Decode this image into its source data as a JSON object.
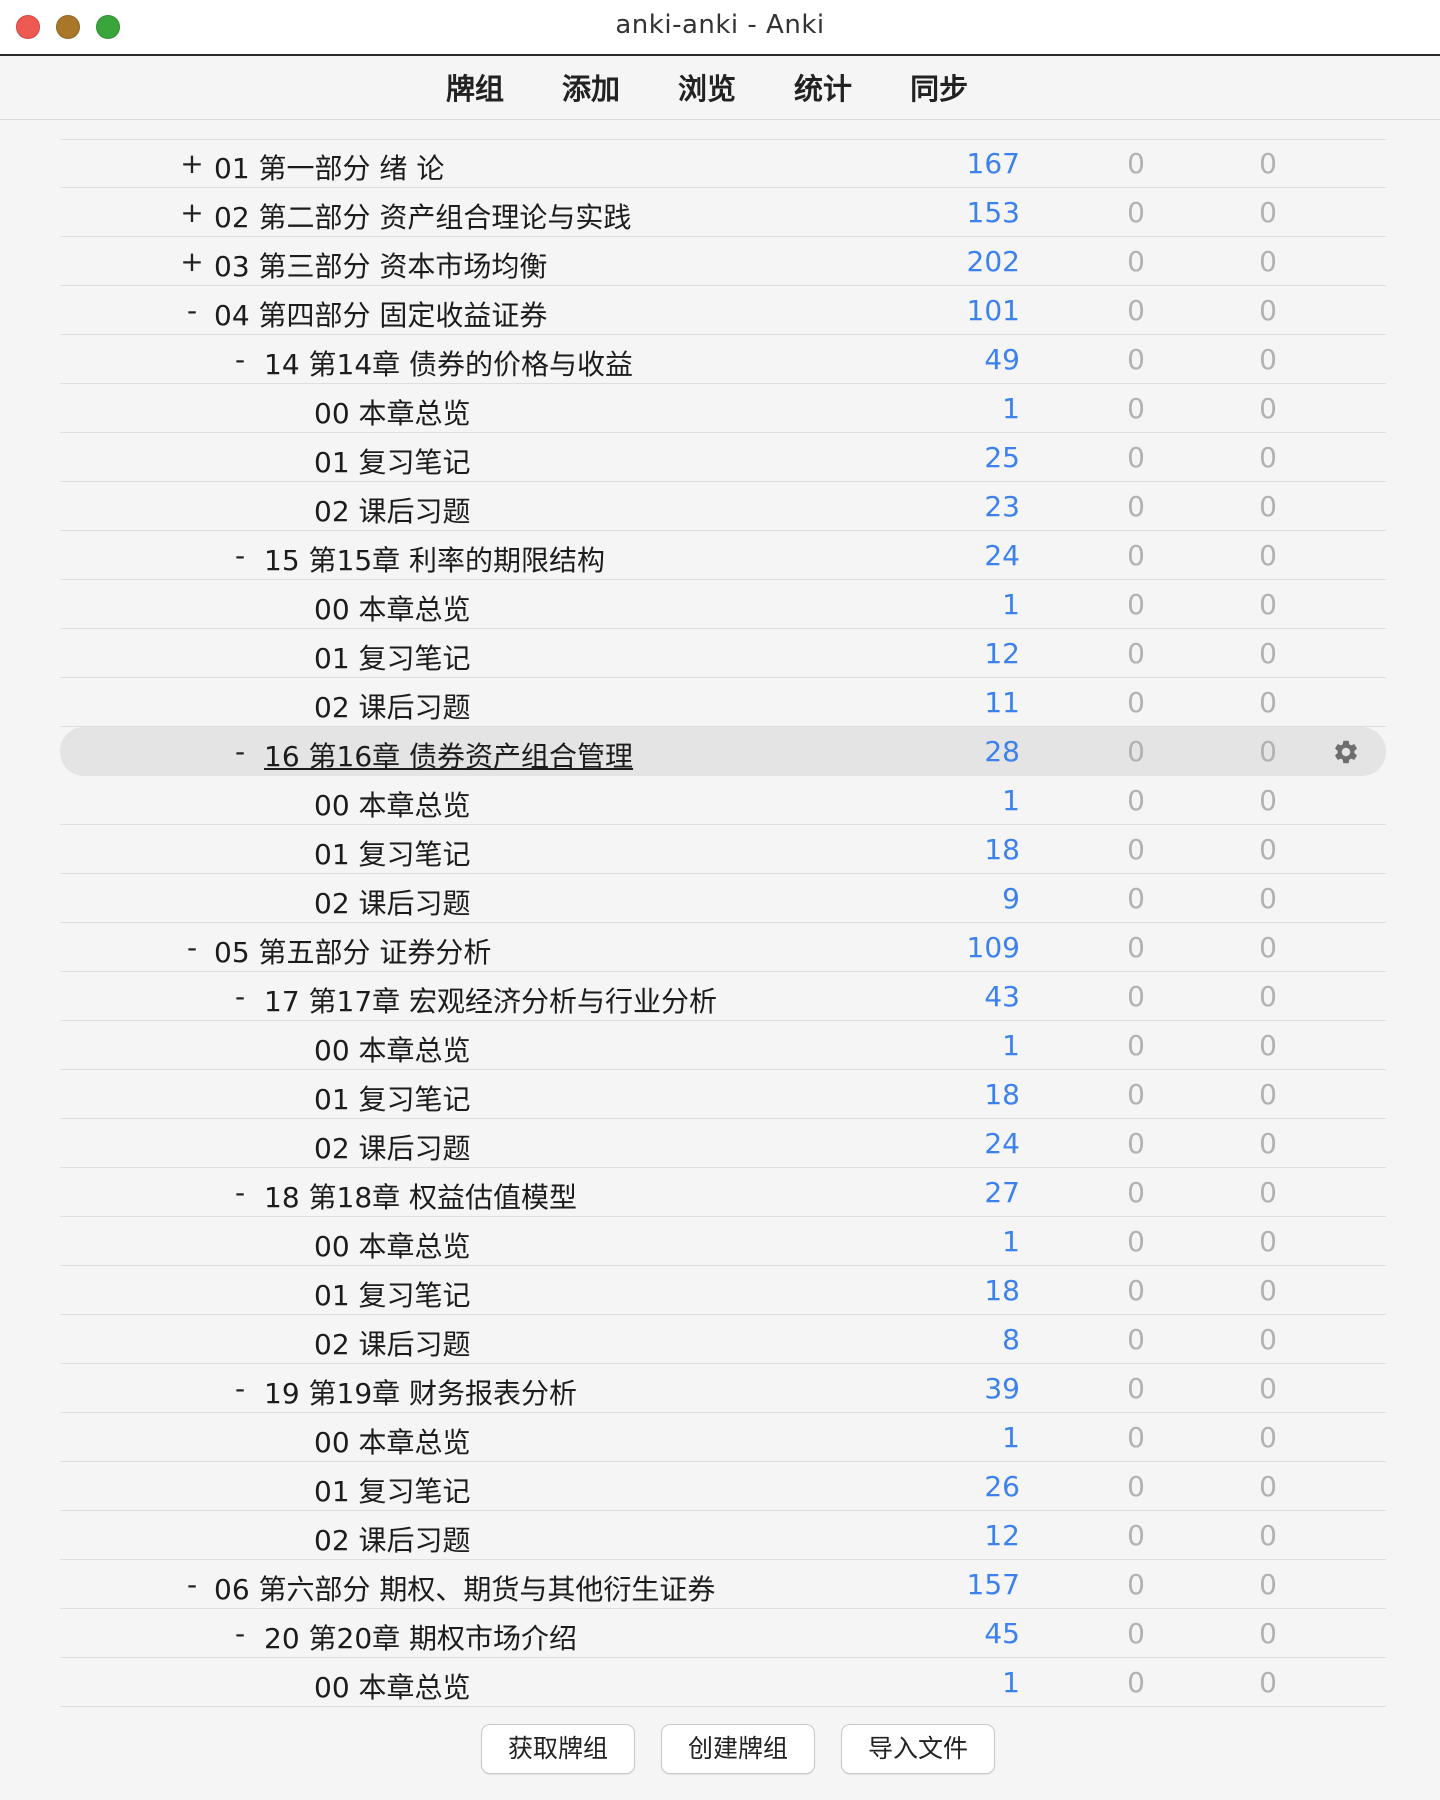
{
  "window": {
    "title": "anki-anki - Anki"
  },
  "toolbar": {
    "tabs": [
      "牌组",
      "添加",
      "浏览",
      "统计",
      "同步"
    ]
  },
  "decks": [
    {
      "toggle": "+",
      "depth": 1,
      "name": "01 第一部分 绪 论",
      "new": "167",
      "c2": "0",
      "c3": "0"
    },
    {
      "toggle": "+",
      "depth": 1,
      "name": "02 第二部分 资产组合理论与实践",
      "new": "153",
      "c2": "0",
      "c3": "0"
    },
    {
      "toggle": "+",
      "depth": 1,
      "name": "03 第三部分 资本市场均衡",
      "new": "202",
      "c2": "0",
      "c3": "0"
    },
    {
      "toggle": "-",
      "depth": 1,
      "name": "04 第四部分 固定收益证券",
      "new": "101",
      "c2": "0",
      "c3": "0"
    },
    {
      "toggle": "-",
      "depth": 2,
      "name": "14 第14章 债券的价格与收益",
      "new": "49",
      "c2": "0",
      "c3": "0"
    },
    {
      "toggle": "",
      "depth": 3,
      "name": "00 本章总览",
      "new": "1",
      "c2": "0",
      "c3": "0"
    },
    {
      "toggle": "",
      "depth": 3,
      "name": "01 复习笔记",
      "new": "25",
      "c2": "0",
      "c3": "0"
    },
    {
      "toggle": "",
      "depth": 3,
      "name": "02 课后习题",
      "new": "23",
      "c2": "0",
      "c3": "0"
    },
    {
      "toggle": "-",
      "depth": 2,
      "name": "15 第15章 利率的期限结构",
      "new": "24",
      "c2": "0",
      "c3": "0"
    },
    {
      "toggle": "",
      "depth": 3,
      "name": "00 本章总览",
      "new": "1",
      "c2": "0",
      "c3": "0"
    },
    {
      "toggle": "",
      "depth": 3,
      "name": "01 复习笔记",
      "new": "12",
      "c2": "0",
      "c3": "0"
    },
    {
      "toggle": "",
      "depth": 3,
      "name": "02 课后习题",
      "new": "11",
      "c2": "0",
      "c3": "0"
    },
    {
      "toggle": "-",
      "depth": 2,
      "name": "16 第16章 债券资产组合管理",
      "new": "28",
      "c2": "0",
      "c3": "0",
      "selected": true
    },
    {
      "toggle": "",
      "depth": 3,
      "name": "00 本章总览",
      "new": "1",
      "c2": "0",
      "c3": "0"
    },
    {
      "toggle": "",
      "depth": 3,
      "name": "01 复习笔记",
      "new": "18",
      "c2": "0",
      "c3": "0"
    },
    {
      "toggle": "",
      "depth": 3,
      "name": "02 课后习题",
      "new": "9",
      "c2": "0",
      "c3": "0"
    },
    {
      "toggle": "-",
      "depth": 1,
      "name": "05 第五部分 证券分析",
      "new": "109",
      "c2": "0",
      "c3": "0"
    },
    {
      "toggle": "-",
      "depth": 2,
      "name": "17 第17章 宏观经济分析与行业分析",
      "new": "43",
      "c2": "0",
      "c3": "0"
    },
    {
      "toggle": "",
      "depth": 3,
      "name": "00 本章总览",
      "new": "1",
      "c2": "0",
      "c3": "0"
    },
    {
      "toggle": "",
      "depth": 3,
      "name": "01 复习笔记",
      "new": "18",
      "c2": "0",
      "c3": "0"
    },
    {
      "toggle": "",
      "depth": 3,
      "name": "02 课后习题",
      "new": "24",
      "c2": "0",
      "c3": "0"
    },
    {
      "toggle": "-",
      "depth": 2,
      "name": "18 第18章 权益估值模型",
      "new": "27",
      "c2": "0",
      "c3": "0"
    },
    {
      "toggle": "",
      "depth": 3,
      "name": "00 本章总览",
      "new": "1",
      "c2": "0",
      "c3": "0"
    },
    {
      "toggle": "",
      "depth": 3,
      "name": "01 复习笔记",
      "new": "18",
      "c2": "0",
      "c3": "0"
    },
    {
      "toggle": "",
      "depth": 3,
      "name": "02 课后习题",
      "new": "8",
      "c2": "0",
      "c3": "0"
    },
    {
      "toggle": "-",
      "depth": 2,
      "name": "19 第19章 财务报表分析",
      "new": "39",
      "c2": "0",
      "c3": "0"
    },
    {
      "toggle": "",
      "depth": 3,
      "name": "00 本章总览",
      "new": "1",
      "c2": "0",
      "c3": "0"
    },
    {
      "toggle": "",
      "depth": 3,
      "name": "01 复习笔记",
      "new": "26",
      "c2": "0",
      "c3": "0"
    },
    {
      "toggle": "",
      "depth": 3,
      "name": "02 课后习题",
      "new": "12",
      "c2": "0",
      "c3": "0"
    },
    {
      "toggle": "-",
      "depth": 1,
      "name": "06 第六部分 期权、期货与其他衍生证券",
      "new": "157",
      "c2": "0",
      "c3": "0"
    },
    {
      "toggle": "-",
      "depth": 2,
      "name": "20 第20章 期权市场介绍",
      "new": "45",
      "c2": "0",
      "c3": "0"
    },
    {
      "toggle": "",
      "depth": 3,
      "name": "00 本章总览",
      "new": "1",
      "c2": "0",
      "c3": "0"
    }
  ],
  "bottom": {
    "get_shared": "获取牌组",
    "create_deck": "创建牌组",
    "import_file": "导入文件"
  },
  "colors": {
    "new_count": "#3b82f0",
    "zero_count": "#b2b2b2",
    "selected_row": "#e4e4e4"
  },
  "icons": {
    "options": "gear-icon"
  }
}
